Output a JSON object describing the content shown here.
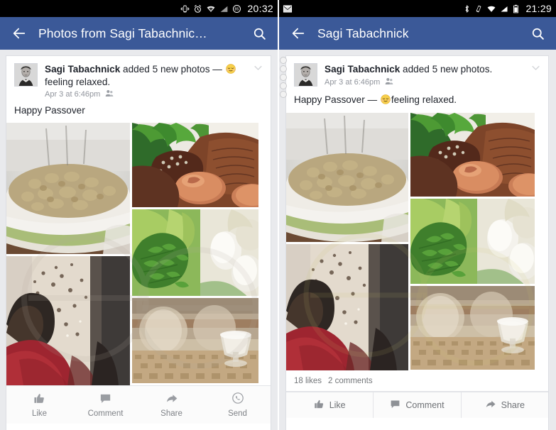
{
  "left_phone": {
    "statusbar": {
      "icons": [
        "vibrate-icon",
        "alarm-clock-icon",
        "wifi-icon",
        "signal-icon",
        "battery-icon"
      ],
      "battery_level": "85",
      "time": "20:32"
    },
    "actionbar": {
      "back_icon": "arrow-back-icon",
      "title": "Photos from Sagi Tabachnic…",
      "search_icon": "search-icon"
    },
    "post": {
      "author": "Sagi Tabachnick",
      "action_text": " added 5 new photos — ",
      "feeling": "feeling relaxed.",
      "emoji": "relaxed-face-emoji",
      "timestamp": "Apr 3 at 6:46pm",
      "privacy_icon": "friends-icon",
      "chevron_icon": "chevron-down-icon",
      "message": "Happy Passover",
      "photos": [
        {
          "name": "photo-bowl-of-grain",
          "alt": "bowl of cooked grain"
        },
        {
          "name": "photo-person-red-sweater",
          "alt": "person in red sweater"
        },
        {
          "name": "photo-seder-plate-egg",
          "alt": "seder plate with egg"
        },
        {
          "name": "photo-herbs-and-eggs",
          "alt": "parsley herbs with white eggs"
        },
        {
          "name": "photo-glasses-on-table",
          "alt": "glasses on a table"
        }
      ]
    },
    "footer_actions": [
      {
        "label": "Like",
        "icon": "thumbs-up-icon"
      },
      {
        "label": "Comment",
        "icon": "comment-icon"
      },
      {
        "label": "Share",
        "icon": "share-arrow-icon"
      },
      {
        "label": "Send",
        "icon": "whatsapp-send-icon"
      }
    ]
  },
  "right_phone": {
    "statusbar": {
      "left_icons": [
        "gmail-icon"
      ],
      "icons": [
        "bluetooth-icon",
        "vibrate-icon",
        "wifi-icon",
        "signal-icon",
        "battery-icon"
      ],
      "time": "21:29"
    },
    "actionbar": {
      "back_icon": "arrow-back-icon",
      "title": "Sagi Tabachnick",
      "search_icon": "search-icon"
    },
    "post": {
      "author": "Sagi Tabachnick",
      "action_text": " added 5 new photos.",
      "timestamp": "Apr 3 at 6:46pm",
      "privacy_icon": "friends-icon",
      "chevron_icon": "chevron-down-icon",
      "message_prefix": "Happy Passover — ",
      "emoji": "relaxed-face-emoji",
      "message_suffix": "feeling relaxed.",
      "photos": [
        {
          "name": "photo-bowl-of-grain",
          "alt": "bowl of cooked grain"
        },
        {
          "name": "photo-person-red-sweater",
          "alt": "person in red sweater"
        },
        {
          "name": "photo-seder-plate-egg",
          "alt": "seder plate with egg"
        },
        {
          "name": "photo-herbs-and-eggs",
          "alt": "parsley herbs with white eggs"
        },
        {
          "name": "photo-glasses-on-table",
          "alt": "glasses on a table"
        }
      ]
    },
    "engagement": {
      "likes": "18 likes",
      "comments": "2 comments"
    },
    "footer_actions": [
      {
        "label": "Like",
        "icon": "thumbs-up-icon"
      },
      {
        "label": "Comment",
        "icon": "comment-icon"
      },
      {
        "label": "Share",
        "icon": "share-arrow-icon"
      }
    ]
  },
  "colors": {
    "facebook_blue": "#3b5998",
    "page_background": "#e9eaed",
    "card_background": "#ffffff",
    "primary_text": "#1d2129",
    "secondary_text": "#90949c",
    "statusbar_background": "#000000",
    "emoji_yellow": "#f5c451"
  }
}
